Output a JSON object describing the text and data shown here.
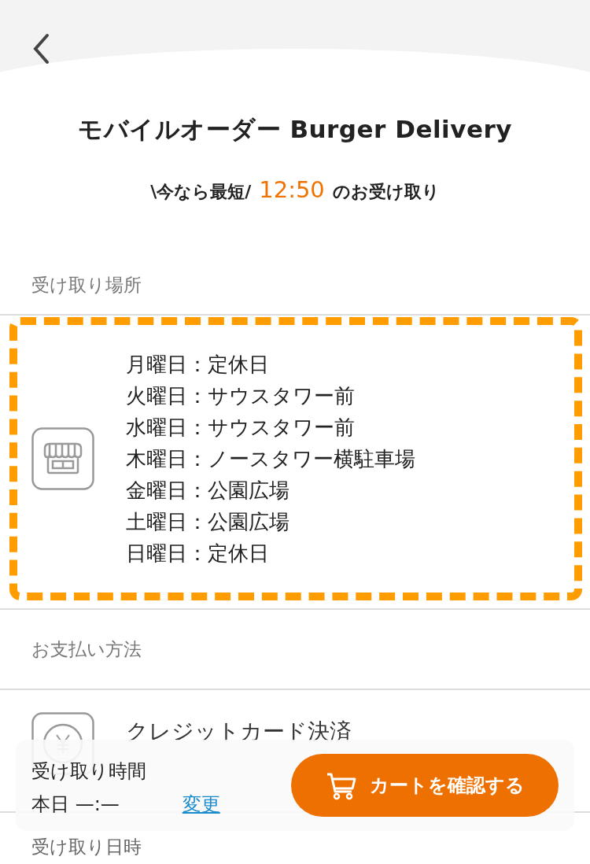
{
  "header": {
    "title": "モバイルオーダー Burger Delivery",
    "subtitle": {
      "prefix": "\\今なら最短/",
      "time": "12:50",
      "suffix": "のお受け取り"
    }
  },
  "pickup_location": {
    "label": "受け取り場所",
    "schedule": [
      "月曜日：定休日",
      "火曜日：サウスタワー前",
      "水曜日：サウスタワー前",
      "木曜日：ノースタワー横駐車場",
      "金曜日：公園広場",
      "土曜日：公園広場",
      "日曜日：定休日"
    ]
  },
  "payment": {
    "label": "お支払い方法",
    "method": "クレジットカード決済"
  },
  "pickup_datetime": {
    "label": "受け取り日時"
  },
  "bottom_bar": {
    "time_label": "受け取り時間",
    "time_value": "本日 —:—",
    "change_link": "変更",
    "cart_button": "カートを確認する"
  }
}
